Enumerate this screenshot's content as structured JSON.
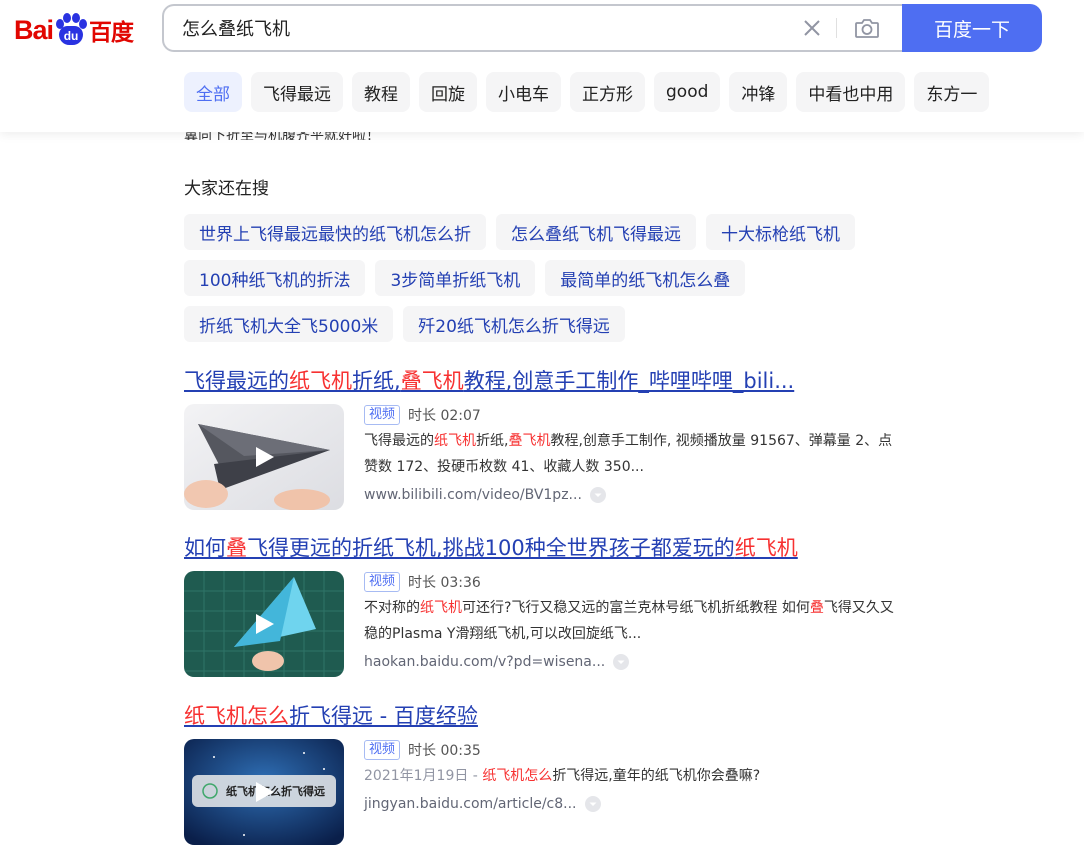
{
  "logo": {
    "latin": "Bai",
    "pad": "du",
    "chinese": "百度"
  },
  "search": {
    "query": "怎么叠纸飞机",
    "button_label": "百度一下"
  },
  "tabs": [
    "全部",
    "飞得最远",
    "教程",
    "回旋",
    "小电车",
    "正方形",
    "good",
    "冲锋",
    "中看也中用",
    "东方一"
  ],
  "cut_text": "翼向下折至与机腹齐平就好啦！",
  "related": {
    "title": "大家还在搜",
    "rows": [
      [
        "世界上飞得最远最快的纸飞机怎么折",
        "怎么叠纸飞机飞得最远",
        "十大标枪纸飞机"
      ],
      [
        "100种纸飞机的折法",
        "3步简单折纸飞机",
        "最简单的纸飞机怎么叠"
      ],
      [
        "折纸飞机大全飞5000米",
        "歼20纸飞机怎么折飞得远"
      ]
    ]
  },
  "results": [
    {
      "title_parts": [
        {
          "t": "飞得最远的",
          "hl": false
        },
        {
          "t": "纸飞机",
          "hl": true
        },
        {
          "t": "折纸,",
          "hl": false
        },
        {
          "t": "叠飞机",
          "hl": true
        },
        {
          "t": "教程,创意手工制作_哔哩哔哩_bili...",
          "hl": false
        }
      ],
      "tag": "视频",
      "duration": "时长 02:07",
      "desc_parts": [
        {
          "t": "飞得最远的",
          "hl": false
        },
        {
          "t": "纸飞机",
          "hl": true
        },
        {
          "t": "折纸,",
          "hl": false
        },
        {
          "t": "叠飞机",
          "hl": true
        },
        {
          "t": "教程,创意手工制作, 视频播放量 91567、弹幕量 2、点赞数 172、投硬币枚数 41、收藏人数 350...",
          "hl": false
        }
      ],
      "url": "www.bilibili.com/video/BV1pz..."
    },
    {
      "title_parts": [
        {
          "t": "如何",
          "hl": false
        },
        {
          "t": "叠",
          "hl": true
        },
        {
          "t": "飞得更远的折纸飞机,挑战100种全世界孩子都爱玩的",
          "hl": false
        },
        {
          "t": "纸飞机",
          "hl": true
        }
      ],
      "tag": "视频",
      "duration": "时长 03:36",
      "desc_parts": [
        {
          "t": "不对称的",
          "hl": false
        },
        {
          "t": "纸飞机",
          "hl": true
        },
        {
          "t": "可还行?飞行又稳又远的富兰克林号纸飞机折纸教程 如何",
          "hl": false
        },
        {
          "t": "叠",
          "hl": true
        },
        {
          "t": "飞得又久又稳的Plasma Y滑翔纸飞机,可以改回旋纸飞...",
          "hl": false
        }
      ],
      "url": "haokan.baidu.com/v?pd=wisena..."
    },
    {
      "title_parts": [
        {
          "t": "纸飞机怎么",
          "hl": true
        },
        {
          "t": "折飞得远 - 百度经验",
          "hl": false
        }
      ],
      "tag": "视频",
      "duration": "时长 00:35",
      "date": "2021年1月19日 - ",
      "desc_parts": [
        {
          "t": "纸飞机怎么",
          "hl": true
        },
        {
          "t": "折飞得远,童年的纸飞机你会叠嘛?",
          "hl": false
        }
      ],
      "url": "jingyan.baidu.com/article/c8...",
      "thumb_caption": "纸飞机怎么折飞得远"
    }
  ],
  "colors": {
    "brand_blue": "#4e6ef2",
    "link": "#2440b3",
    "highlight": "#f73131",
    "logo_red": "#e10601"
  }
}
